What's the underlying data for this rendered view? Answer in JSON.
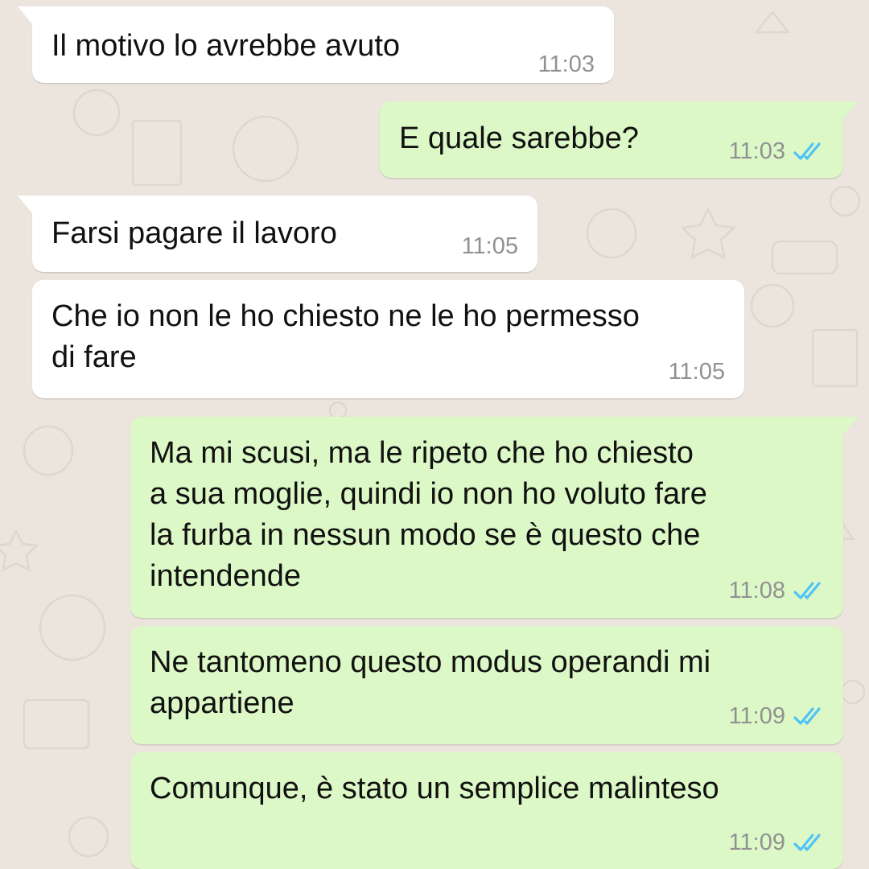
{
  "colors": {
    "background": "#ece5dd",
    "incoming_bubble": "#ffffff",
    "outgoing_bubble": "#dcf8c6",
    "time_text": "#919191",
    "read_ticks": "#4fc3f7"
  },
  "messages": [
    {
      "direction": "incoming",
      "lines": [
        "Il motivo lo avrebbe avuto"
      ],
      "time": "11:03",
      "status": null
    },
    {
      "direction": "outgoing",
      "lines": [
        "E quale sarebbe?"
      ],
      "time": "11:03",
      "status": "read-double-check-icon"
    },
    {
      "direction": "incoming",
      "lines": [
        "Farsi pagare il lavoro"
      ],
      "time": "11:05",
      "status": null
    },
    {
      "direction": "incoming",
      "lines": [
        "Che io non le ho chiesto ne le ho permesso",
        "di fare"
      ],
      "time": "11:05",
      "status": null
    },
    {
      "direction": "outgoing",
      "lines": [
        "Ma mi scusi, ma le ripeto che ho chiesto",
        "a sua moglie, quindi io non ho voluto fare",
        "la furba in nessun modo se è questo che",
        "intendende"
      ],
      "time": "11:08",
      "status": "read-double-check-icon"
    },
    {
      "direction": "outgoing",
      "lines": [
        "Ne tantomeno questo modus operandi mi",
        "appartiene"
      ],
      "time": "11:09",
      "status": "read-double-check-icon"
    },
    {
      "direction": "outgoing",
      "lines": [
        "Comunque, è stato un semplice malinteso"
      ],
      "time": "11:09",
      "status": "read-double-check-icon"
    }
  ]
}
